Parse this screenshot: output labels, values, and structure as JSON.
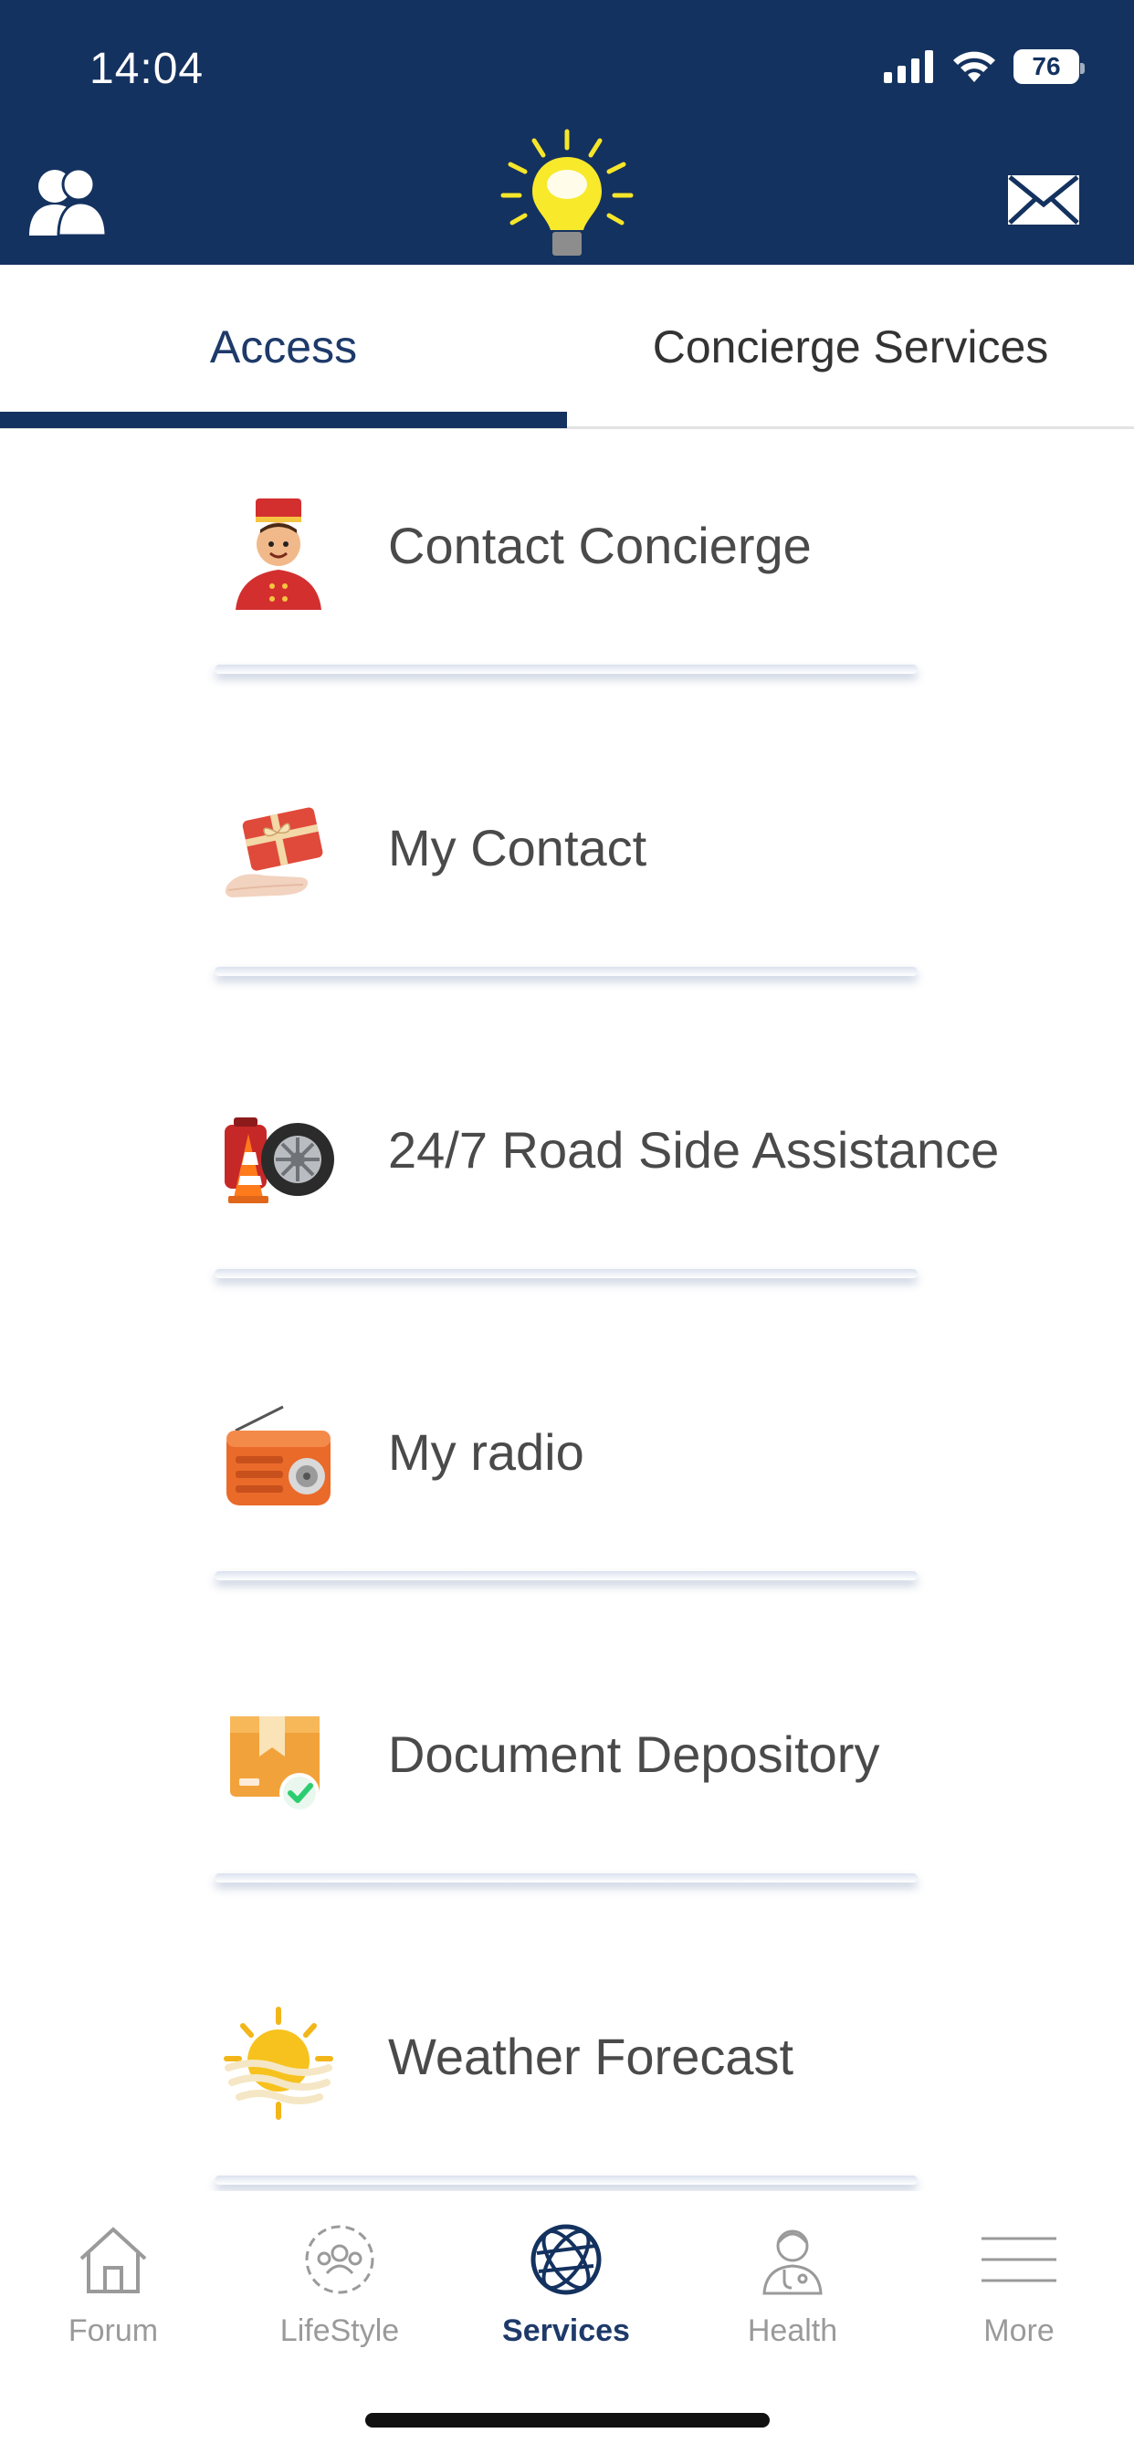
{
  "status": {
    "time": "14:04",
    "battery": "76"
  },
  "header": {
    "left_icon": "users-icon",
    "center_icon": "lightbulb-logo",
    "right_icon": "mail-icon"
  },
  "tabs": [
    {
      "label": "Access",
      "active": true
    },
    {
      "label": "Concierge Services",
      "active": false
    }
  ],
  "services": [
    {
      "label": "Contact Concierge",
      "icon": "bellboy-icon"
    },
    {
      "label": "My Contact",
      "icon": "gift-card-hand-icon"
    },
    {
      "label": "24/7 Road Side Assistance",
      "icon": "tire-cone-icon"
    },
    {
      "label": "My radio",
      "icon": "radio-icon"
    },
    {
      "label": "Document Depository",
      "icon": "document-box-icon"
    },
    {
      "label": "Weather Forecast",
      "icon": "sun-weather-icon"
    }
  ],
  "bottom_nav": [
    {
      "label": "Forum",
      "icon": "home-icon",
      "active": false
    },
    {
      "label": "LifeStyle",
      "icon": "community-icon",
      "active": false
    },
    {
      "label": "Services",
      "icon": "globe-icon",
      "active": true
    },
    {
      "label": "Health",
      "icon": "doctor-icon",
      "active": false
    },
    {
      "label": "More",
      "icon": "menu-icon",
      "active": false
    }
  ],
  "colors": {
    "primary": "#14325f",
    "active_text": "#1e3a6a",
    "inactive_text": "#9a9a9a"
  }
}
